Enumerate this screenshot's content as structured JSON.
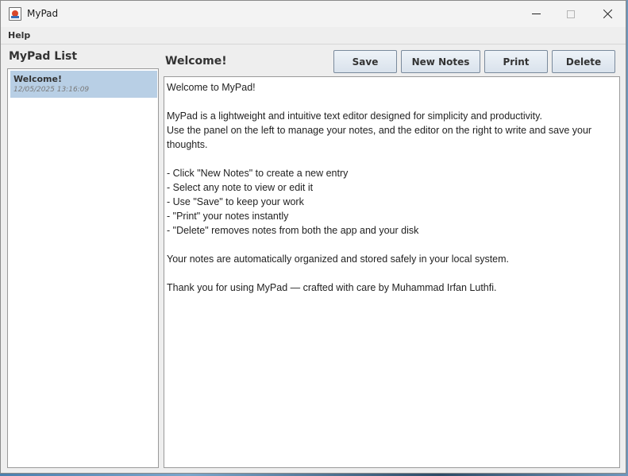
{
  "window": {
    "title": "MyPad",
    "icon": "java-app-icon"
  },
  "menubar": {
    "items": [
      {
        "label": "Help"
      }
    ]
  },
  "sidebar": {
    "heading": "MyPad List",
    "notes": [
      {
        "title": "Welcome!",
        "date": "12/05/2025 13:16:09",
        "selected": true
      }
    ]
  },
  "editor": {
    "title": "Welcome!",
    "content": "Welcome to MyPad!\n\nMyPad is a lightweight and intuitive text editor designed for simplicity and productivity.\nUse the panel on the left to manage your notes, and the editor on the right to write and save your thoughts.\n\n- Click \"New Notes\" to create a new entry\n- Select any note to view or edit it\n- Use \"Save\" to keep your work\n- \"Print\" your notes instantly\n- \"Delete\" removes notes from both the app and your disk\n\nYour notes are automatically organized and stored safely in your local system.\n\nThank you for using MyPad — crafted with care by Muhammad Irfan Luthfi."
  },
  "toolbar": {
    "save_label": "Save",
    "new_label": "New Notes",
    "print_label": "Print",
    "delete_label": "Delete"
  },
  "colors": {
    "selection": "#b8cfe5",
    "window_bg": "#eeeeee"
  }
}
